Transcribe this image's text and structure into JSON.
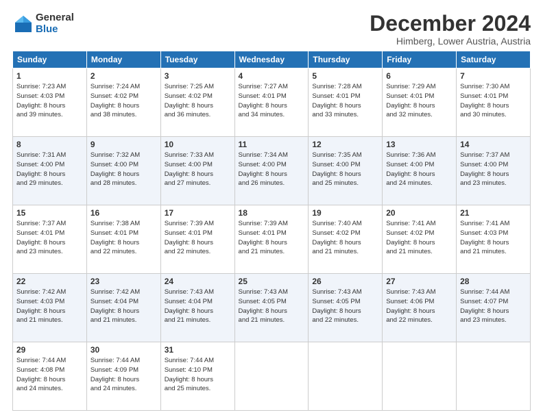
{
  "logo": {
    "general": "General",
    "blue": "Blue"
  },
  "title": "December 2024",
  "location": "Himberg, Lower Austria, Austria",
  "headers": [
    "Sunday",
    "Monday",
    "Tuesday",
    "Wednesday",
    "Thursday",
    "Friday",
    "Saturday"
  ],
  "weeks": [
    [
      {
        "day": "1",
        "info": "Sunrise: 7:23 AM\nSunset: 4:03 PM\nDaylight: 8 hours\nand 39 minutes."
      },
      {
        "day": "2",
        "info": "Sunrise: 7:24 AM\nSunset: 4:02 PM\nDaylight: 8 hours\nand 38 minutes."
      },
      {
        "day": "3",
        "info": "Sunrise: 7:25 AM\nSunset: 4:02 PM\nDaylight: 8 hours\nand 36 minutes."
      },
      {
        "day": "4",
        "info": "Sunrise: 7:27 AM\nSunset: 4:01 PM\nDaylight: 8 hours\nand 34 minutes."
      },
      {
        "day": "5",
        "info": "Sunrise: 7:28 AM\nSunset: 4:01 PM\nDaylight: 8 hours\nand 33 minutes."
      },
      {
        "day": "6",
        "info": "Sunrise: 7:29 AM\nSunset: 4:01 PM\nDaylight: 8 hours\nand 32 minutes."
      },
      {
        "day": "7",
        "info": "Sunrise: 7:30 AM\nSunset: 4:01 PM\nDaylight: 8 hours\nand 30 minutes."
      }
    ],
    [
      {
        "day": "8",
        "info": "Sunrise: 7:31 AM\nSunset: 4:00 PM\nDaylight: 8 hours\nand 29 minutes."
      },
      {
        "day": "9",
        "info": "Sunrise: 7:32 AM\nSunset: 4:00 PM\nDaylight: 8 hours\nand 28 minutes."
      },
      {
        "day": "10",
        "info": "Sunrise: 7:33 AM\nSunset: 4:00 PM\nDaylight: 8 hours\nand 27 minutes."
      },
      {
        "day": "11",
        "info": "Sunrise: 7:34 AM\nSunset: 4:00 PM\nDaylight: 8 hours\nand 26 minutes."
      },
      {
        "day": "12",
        "info": "Sunrise: 7:35 AM\nSunset: 4:00 PM\nDaylight: 8 hours\nand 25 minutes."
      },
      {
        "day": "13",
        "info": "Sunrise: 7:36 AM\nSunset: 4:00 PM\nDaylight: 8 hours\nand 24 minutes."
      },
      {
        "day": "14",
        "info": "Sunrise: 7:37 AM\nSunset: 4:00 PM\nDaylight: 8 hours\nand 23 minutes."
      }
    ],
    [
      {
        "day": "15",
        "info": "Sunrise: 7:37 AM\nSunset: 4:01 PM\nDaylight: 8 hours\nand 23 minutes."
      },
      {
        "day": "16",
        "info": "Sunrise: 7:38 AM\nSunset: 4:01 PM\nDaylight: 8 hours\nand 22 minutes."
      },
      {
        "day": "17",
        "info": "Sunrise: 7:39 AM\nSunset: 4:01 PM\nDaylight: 8 hours\nand 22 minutes."
      },
      {
        "day": "18",
        "info": "Sunrise: 7:39 AM\nSunset: 4:01 PM\nDaylight: 8 hours\nand 21 minutes."
      },
      {
        "day": "19",
        "info": "Sunrise: 7:40 AM\nSunset: 4:02 PM\nDaylight: 8 hours\nand 21 minutes."
      },
      {
        "day": "20",
        "info": "Sunrise: 7:41 AM\nSunset: 4:02 PM\nDaylight: 8 hours\nand 21 minutes."
      },
      {
        "day": "21",
        "info": "Sunrise: 7:41 AM\nSunset: 4:03 PM\nDaylight: 8 hours\nand 21 minutes."
      }
    ],
    [
      {
        "day": "22",
        "info": "Sunrise: 7:42 AM\nSunset: 4:03 PM\nDaylight: 8 hours\nand 21 minutes."
      },
      {
        "day": "23",
        "info": "Sunrise: 7:42 AM\nSunset: 4:04 PM\nDaylight: 8 hours\nand 21 minutes."
      },
      {
        "day": "24",
        "info": "Sunrise: 7:43 AM\nSunset: 4:04 PM\nDaylight: 8 hours\nand 21 minutes."
      },
      {
        "day": "25",
        "info": "Sunrise: 7:43 AM\nSunset: 4:05 PM\nDaylight: 8 hours\nand 21 minutes."
      },
      {
        "day": "26",
        "info": "Sunrise: 7:43 AM\nSunset: 4:05 PM\nDaylight: 8 hours\nand 22 minutes."
      },
      {
        "day": "27",
        "info": "Sunrise: 7:43 AM\nSunset: 4:06 PM\nDaylight: 8 hours\nand 22 minutes."
      },
      {
        "day": "28",
        "info": "Sunrise: 7:44 AM\nSunset: 4:07 PM\nDaylight: 8 hours\nand 23 minutes."
      }
    ],
    [
      {
        "day": "29",
        "info": "Sunrise: 7:44 AM\nSunset: 4:08 PM\nDaylight: 8 hours\nand 24 minutes."
      },
      {
        "day": "30",
        "info": "Sunrise: 7:44 AM\nSunset: 4:09 PM\nDaylight: 8 hours\nand 24 minutes."
      },
      {
        "day": "31",
        "info": "Sunrise: 7:44 AM\nSunset: 4:10 PM\nDaylight: 8 hours\nand 25 minutes."
      },
      {
        "day": "",
        "info": ""
      },
      {
        "day": "",
        "info": ""
      },
      {
        "day": "",
        "info": ""
      },
      {
        "day": "",
        "info": ""
      }
    ]
  ]
}
